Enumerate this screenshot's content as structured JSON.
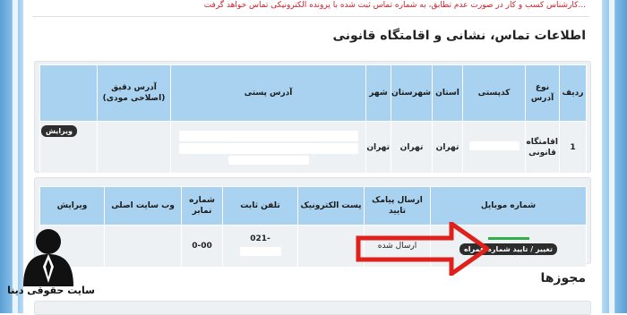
{
  "top_warning": "...کارشناس کسب و کار در صورت عدم تطابق، به شماره تماس ثبت شده با پرونده الکترونیکی تماس خواهد گرفت",
  "contact_section": {
    "title": "اطلاعات تماس، نشانی و اقامتگاه قانونی",
    "headers": [
      "ردیف",
      "نوع آدرس",
      "کدپستی",
      "استان",
      "شهرستان",
      "شهر",
      "آدرس پستی",
      "آدرس دقیق (اصلاحی مودی)",
      ""
    ],
    "row": {
      "index": "1",
      "type": "اقامتگاه قانونی",
      "postal_code": "",
      "province": "تهران",
      "county": "تهران",
      "city": "تهران",
      "address": "",
      "precise_address": "",
      "edit_label": "ویرایش"
    }
  },
  "mobile_section": {
    "headers": [
      "شماره موبایل",
      "ارسال پیامک تایید",
      "پست الکترونیک",
      "تلفن ثابت",
      "شماره نمابر",
      "وب سایت اصلی",
      "ویرایش"
    ],
    "row": {
      "mobile": "",
      "change_label": "تغییر / تایید شماره همراه",
      "sms": "ارسال شده",
      "email": "",
      "phone": "021-",
      "fax": "0-00",
      "website": "",
      "edit": ""
    }
  },
  "permits_section": {
    "title": "مجوزها"
  },
  "logo": {
    "caption": "سایت حقوقی دینا",
    "icon": "lawyer-bust-icon"
  },
  "colors": {
    "header_bg": "#a9d2f0",
    "panel_bg": "#eef1f4",
    "arrow": "#e0201b",
    "frame": "#5a9fd4",
    "warning": "#d11e2a"
  }
}
